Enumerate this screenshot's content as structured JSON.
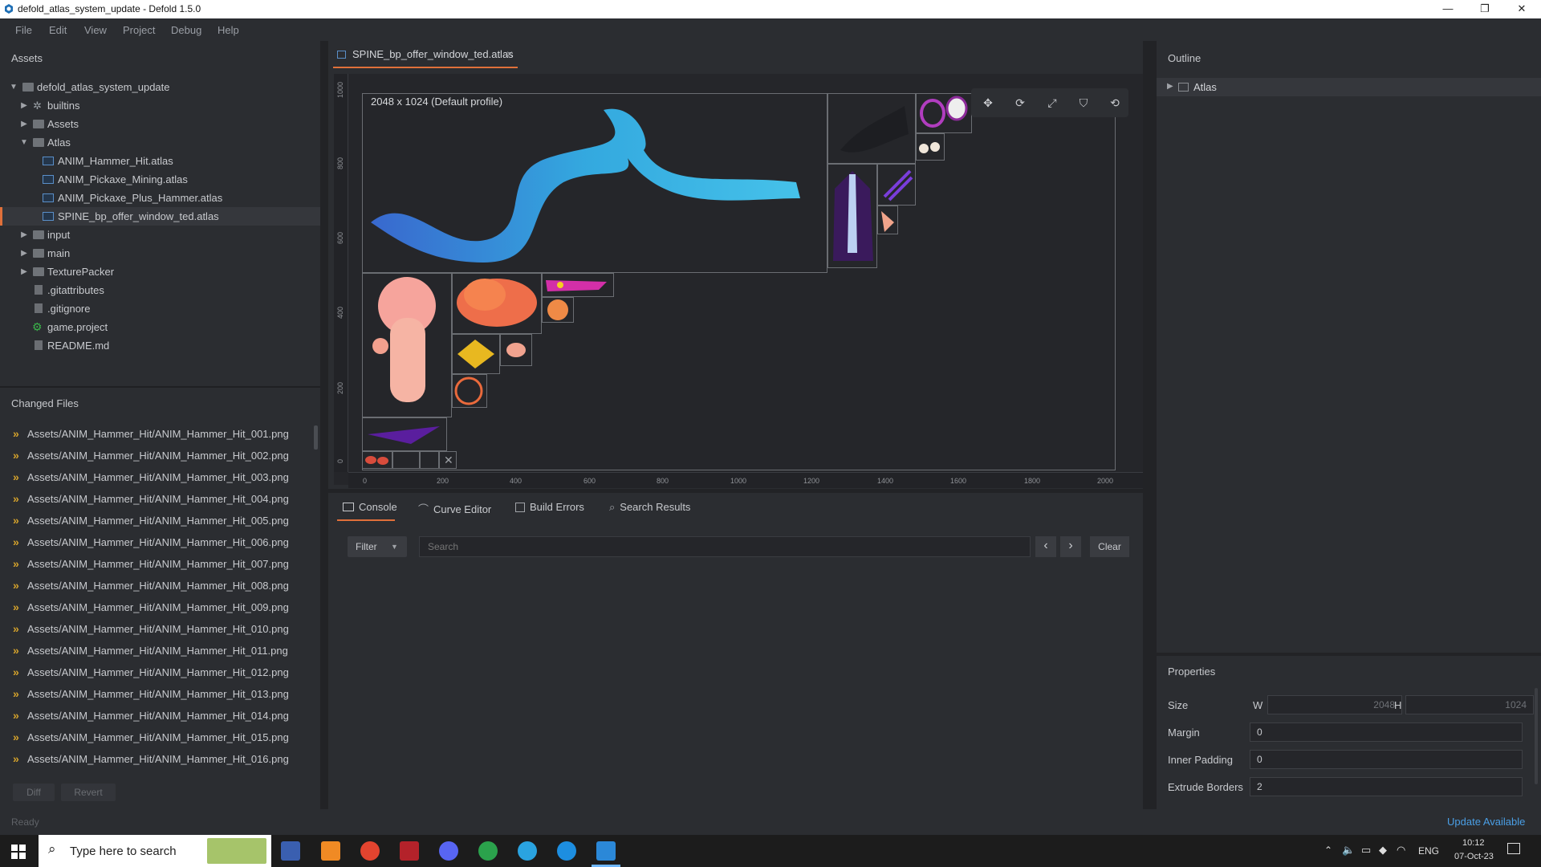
{
  "window": {
    "title": "defold_atlas_system_update - Defold 1.5.0",
    "minimize": "—",
    "maximize": "❐",
    "close": "✕"
  },
  "menu": [
    "File",
    "Edit",
    "View",
    "Project",
    "Debug",
    "Help"
  ],
  "assets": {
    "header": "Assets",
    "items": [
      {
        "label": "defold_atlas_system_update"
      },
      {
        "label": "builtins"
      },
      {
        "label": "Assets"
      },
      {
        "label": "Atlas"
      },
      {
        "label": "ANIM_Hammer_Hit.atlas"
      },
      {
        "label": "ANIM_Pickaxe_Mining.atlas"
      },
      {
        "label": "ANIM_Pickaxe_Plus_Hammer.atlas"
      },
      {
        "label": "SPINE_bp_offer_window_ted.atlas"
      },
      {
        "label": "input"
      },
      {
        "label": "main"
      },
      {
        "label": "TexturePacker"
      },
      {
        "label": ".gitattributes"
      },
      {
        "label": ".gitignore"
      },
      {
        "label": "game.project"
      },
      {
        "label": "README.md"
      }
    ]
  },
  "changed_files": {
    "header": "Changed Files",
    "files": [
      "Assets/ANIM_Hammer_Hit/ANIM_Hammer_Hit_001.png",
      "Assets/ANIM_Hammer_Hit/ANIM_Hammer_Hit_002.png",
      "Assets/ANIM_Hammer_Hit/ANIM_Hammer_Hit_003.png",
      "Assets/ANIM_Hammer_Hit/ANIM_Hammer_Hit_004.png",
      "Assets/ANIM_Hammer_Hit/ANIM_Hammer_Hit_005.png",
      "Assets/ANIM_Hammer_Hit/ANIM_Hammer_Hit_006.png",
      "Assets/ANIM_Hammer_Hit/ANIM_Hammer_Hit_007.png",
      "Assets/ANIM_Hammer_Hit/ANIM_Hammer_Hit_008.png",
      "Assets/ANIM_Hammer_Hit/ANIM_Hammer_Hit_009.png",
      "Assets/ANIM_Hammer_Hit/ANIM_Hammer_Hit_010.png",
      "Assets/ANIM_Hammer_Hit/ANIM_Hammer_Hit_011.png",
      "Assets/ANIM_Hammer_Hit/ANIM_Hammer_Hit_012.png",
      "Assets/ANIM_Hammer_Hit/ANIM_Hammer_Hit_013.png",
      "Assets/ANIM_Hammer_Hit/ANIM_Hammer_Hit_014.png",
      "Assets/ANIM_Hammer_Hit/ANIM_Hammer_Hit_015.png",
      "Assets/ANIM_Hammer_Hit/ANIM_Hammer_Hit_016.png"
    ],
    "diff": "Diff",
    "revert": "Revert"
  },
  "editor": {
    "tab": "SPINE_bp_offer_window_ted.atlas",
    "tab_close": "×",
    "canvas_label": "2048 x 1024 (Default profile)",
    "ruler_x": [
      "0",
      "200",
      "400",
      "600",
      "800",
      "1000",
      "1200",
      "1400",
      "1600",
      "1800",
      "2000"
    ],
    "ruler_y": [
      "1000",
      "800",
      "600",
      "400",
      "200",
      "0"
    ]
  },
  "console": {
    "tabs": [
      "Console",
      "Curve Editor",
      "Build Errors",
      "Search Results"
    ],
    "filter": "Filter",
    "search_placeholder": "Search",
    "prev": "‹",
    "next": "›",
    "clear": "Clear"
  },
  "outline": {
    "header": "Outline",
    "root": "Atlas"
  },
  "properties": {
    "header": "Properties",
    "size_label": "Size",
    "w_label": "W",
    "w": "2048",
    "h_label": "H",
    "h": "1024",
    "margin_label": "Margin",
    "margin": "0",
    "inner_padding_label": "Inner Padding",
    "inner_padding": "0",
    "extrude_label": "Extrude Borders",
    "extrude": "2"
  },
  "status": {
    "left": "Ready",
    "right": "Update Available"
  },
  "taskbar": {
    "search": "Type here to search",
    "lang": "ENG",
    "time": "10:12",
    "date": "07-Oct-23"
  }
}
